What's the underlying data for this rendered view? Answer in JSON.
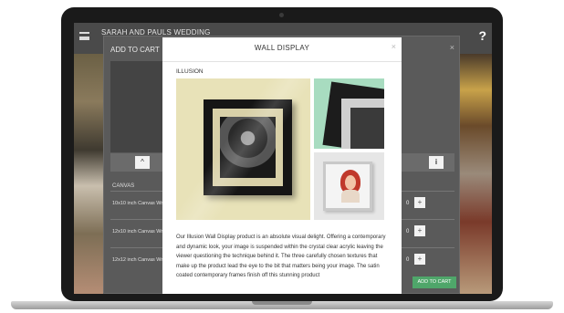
{
  "app": {
    "title": "SARAH AND PAULS WEDDING",
    "help_label": "?"
  },
  "cart_dialog": {
    "title": "ADD TO CART",
    "close_label": "×",
    "up_label": "^",
    "info_label": "i",
    "section_header": "CANVAS",
    "rows": [
      {
        "label": "10x10 inch Canvas Wr...",
        "qty": "0",
        "plus": "+"
      },
      {
        "label": "12x10 inch Canvas Wr...",
        "qty": "0",
        "plus": "+"
      },
      {
        "label": "12x12 inch Canvas Wr...",
        "qty": "0",
        "plus": "+"
      }
    ],
    "add_to_cart_label": "ADD TO CART"
  },
  "modal": {
    "title": "WALL DISPLAY",
    "close_label": "×",
    "product_name": "ILLUSION",
    "description": "Our Illusion Wall Display product is an absolute visual delight. Offering a contemporary and dynamic look, your image is suspended within the crystal clear acrylic leaving the viewer questioning the technique behind it. The three carefully chosen textures that make up the product lead the eye to the bit that matters being your image. The satin coated contemporary frames finish off this stunning product"
  },
  "colors": {
    "accent_green": "#4fa66a",
    "header_bg": "#4a4a4a",
    "overlay": "#5a5a5a"
  }
}
